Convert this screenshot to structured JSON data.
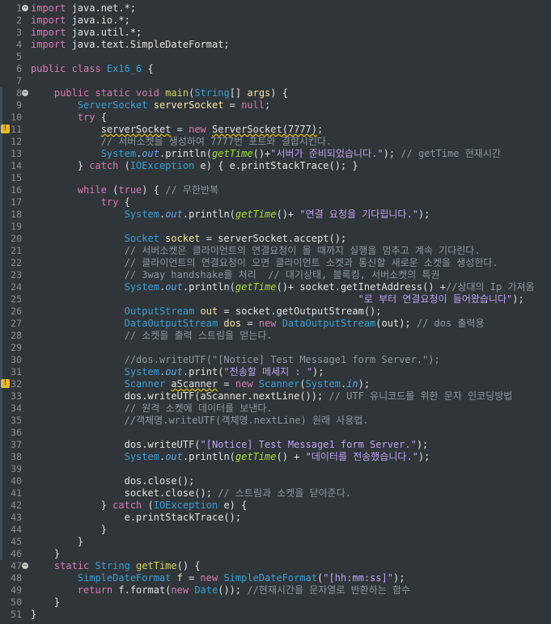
{
  "file": {
    "lines": [
      {
        "n": "1",
        "fold": "minus",
        "tokens": [
          [
            "kw",
            "import "
          ],
          [
            "pl",
            "java.net.*;"
          ]
        ]
      },
      {
        "n": "2",
        "tokens": [
          [
            "kw",
            "import "
          ],
          [
            "pl",
            "java.io.*;"
          ]
        ]
      },
      {
        "n": "3",
        "tokens": [
          [
            "kw",
            "import "
          ],
          [
            "pl",
            "java.util.*;"
          ]
        ]
      },
      {
        "n": "4",
        "tokens": [
          [
            "kw",
            "import "
          ],
          [
            "pl",
            "java.text.SimpleDateFormat;"
          ]
        ]
      },
      {
        "n": "5",
        "tokens": []
      },
      {
        "n": "6",
        "tokens": [
          [
            "kw",
            "public class "
          ],
          [
            "ty",
            "Ex16_6"
          ],
          [
            "pl",
            " {"
          ]
        ]
      },
      {
        "n": "7",
        "tokens": []
      },
      {
        "n": "8",
        "fold": "minus",
        "tokens": [
          [
            "pl",
            "    "
          ],
          [
            "kw",
            "public static void "
          ],
          [
            "fn",
            "main"
          ],
          [
            "pl",
            "("
          ],
          [
            "ty",
            "String"
          ],
          [
            "pl",
            "[] "
          ],
          [
            "var",
            "args"
          ],
          [
            "pl",
            ") {"
          ]
        ]
      },
      {
        "n": "9",
        "tokens": [
          [
            "pl",
            "        "
          ],
          [
            "ty",
            "ServerSocket "
          ],
          [
            "var",
            "serverSocket"
          ],
          [
            "pl",
            " = "
          ],
          [
            "kw",
            "null"
          ],
          [
            "pl",
            ";"
          ]
        ]
      },
      {
        "n": "10",
        "tokens": [
          [
            "pl",
            "        "
          ],
          [
            "kw",
            "try"
          ],
          [
            "pl",
            " {"
          ]
        ]
      },
      {
        "n": "11",
        "warn": true,
        "tokens": [
          [
            "pl",
            "            "
          ],
          [
            "err",
            "serverSocket"
          ],
          [
            "pl",
            " = "
          ],
          [
            "kw",
            "new "
          ],
          [
            "err",
            "ServerSocket(7777)"
          ],
          [
            "pl",
            ";"
          ]
        ]
      },
      {
        "n": "12",
        "tokens": [
          [
            "pl",
            "            "
          ],
          [
            "cm",
            "// 서버소켓을 생성하여 7777번 포트와 결합시킨다."
          ]
        ]
      },
      {
        "n": "13",
        "tokens": [
          [
            "pl",
            "            "
          ],
          [
            "ty",
            "System"
          ],
          [
            "pl",
            "."
          ],
          [
            "fld",
            "out"
          ],
          [
            "pl",
            ".println("
          ],
          [
            "sm",
            "getTime"
          ],
          [
            "pl",
            "()+"
          ],
          [
            "str",
            "\"서버가 준비되었습니다.\""
          ],
          [
            "pl",
            "); "
          ],
          [
            "cm",
            "// getTime 현재시간"
          ]
        ]
      },
      {
        "n": "14",
        "tokens": [
          [
            "pl",
            "        } "
          ],
          [
            "kw",
            "catch"
          ],
          [
            "pl",
            " ("
          ],
          [
            "ty",
            "IOException"
          ],
          [
            "pl",
            " e) { e.printStackTrace(); }"
          ]
        ]
      },
      {
        "n": "15",
        "tokens": []
      },
      {
        "n": "16",
        "tokens": [
          [
            "pl",
            "        "
          ],
          [
            "kw",
            "while"
          ],
          [
            "pl",
            " ("
          ],
          [
            "kw",
            "true"
          ],
          [
            "pl",
            ") { "
          ],
          [
            "cm",
            "// 무한반복"
          ]
        ]
      },
      {
        "n": "17",
        "tokens": [
          [
            "pl",
            "            "
          ],
          [
            "kw",
            "try"
          ],
          [
            "pl",
            " {"
          ]
        ]
      },
      {
        "n": "18",
        "tokens": [
          [
            "pl",
            "                "
          ],
          [
            "ty",
            "System"
          ],
          [
            "pl",
            "."
          ],
          [
            "fld",
            "out"
          ],
          [
            "pl",
            ".println("
          ],
          [
            "sm",
            "getTime"
          ],
          [
            "pl",
            "()+ "
          ],
          [
            "str",
            "\"연결 요청을 기다립니다.\""
          ],
          [
            "pl",
            ");"
          ]
        ]
      },
      {
        "n": "19",
        "tokens": []
      },
      {
        "n": "20",
        "tokens": [
          [
            "pl",
            "                "
          ],
          [
            "ty",
            "Socket "
          ],
          [
            "var",
            "socket"
          ],
          [
            "pl",
            " = serverSocket.accept();"
          ]
        ]
      },
      {
        "n": "21",
        "tokens": [
          [
            "pl",
            "                "
          ],
          [
            "cm",
            "// 서버소켓은 클라이언트의 연결요청이 올 때까지 실행을 멈추고 계속 기다린다."
          ]
        ]
      },
      {
        "n": "22",
        "tokens": [
          [
            "pl",
            "                "
          ],
          [
            "cm",
            "// 클라이언트의 연결요청이 오면 클라이언트 소켓과 통신할 새로운 소켓을 생성한다."
          ]
        ]
      },
      {
        "n": "23",
        "tokens": [
          [
            "pl",
            "                "
          ],
          [
            "cm",
            "// 3way handshake를 처리  // 대기상태, 블록킹, 서버소켓의 특권"
          ]
        ]
      },
      {
        "n": "24",
        "tokens": [
          [
            "pl",
            "                "
          ],
          [
            "ty",
            "System"
          ],
          [
            "pl",
            "."
          ],
          [
            "fld",
            "out"
          ],
          [
            "pl",
            ".println("
          ],
          [
            "sm",
            "getTime"
          ],
          [
            "pl",
            "()+ socket.getInetAddress() +"
          ],
          [
            "cm",
            "//상대의 Ip 가져옴"
          ]
        ]
      },
      {
        "n": "25",
        "tokens": [
          [
            "pl",
            "                                                        "
          ],
          [
            "str",
            "\"로 부터 연결요청이 들어왔습니다\""
          ],
          [
            "pl",
            ");"
          ]
        ]
      },
      {
        "n": "26",
        "tokens": [
          [
            "pl",
            "                "
          ],
          [
            "ty",
            "OutputStream "
          ],
          [
            "var",
            "out"
          ],
          [
            "pl",
            " = socket.getOutputStream();"
          ]
        ]
      },
      {
        "n": "27",
        "tokens": [
          [
            "pl",
            "                "
          ],
          [
            "ty",
            "DataOutputStream "
          ],
          [
            "var",
            "dos"
          ],
          [
            "pl",
            " = "
          ],
          [
            "kw",
            "new "
          ],
          [
            "ty",
            "DataOutputStream"
          ],
          [
            "pl",
            "(out); "
          ],
          [
            "cm",
            "// dos 출력용"
          ]
        ]
      },
      {
        "n": "28",
        "tokens": [
          [
            "pl",
            "                "
          ],
          [
            "cm",
            "// 소켓을 출력 스트림을 얻는다."
          ]
        ]
      },
      {
        "n": "29",
        "tokens": []
      },
      {
        "n": "30",
        "tokens": [
          [
            "pl",
            "                "
          ],
          [
            "cm",
            "//dos.writeUTF(\"[Notice] Test Message1 form Server.\");"
          ]
        ]
      },
      {
        "n": "31",
        "tokens": [
          [
            "pl",
            "                "
          ],
          [
            "ty",
            "System"
          ],
          [
            "pl",
            "."
          ],
          [
            "fld",
            "out"
          ],
          [
            "pl",
            ".print("
          ],
          [
            "str",
            "\"전송할 메세지 : \""
          ],
          [
            "pl",
            ");"
          ]
        ]
      },
      {
        "n": "32",
        "warn": true,
        "tokens": [
          [
            "pl",
            "                "
          ],
          [
            "ty",
            "Scanner "
          ],
          [
            "err",
            "aScanner"
          ],
          [
            "pl",
            " = "
          ],
          [
            "kw",
            "new "
          ],
          [
            "ty",
            "Scanner"
          ],
          [
            "pl",
            "("
          ],
          [
            "ty",
            "System"
          ],
          [
            "pl",
            "."
          ],
          [
            "fld",
            "in"
          ],
          [
            "pl",
            ");"
          ]
        ]
      },
      {
        "n": "33",
        "tokens": [
          [
            "pl",
            "                dos.writeUTF(aScanner.nextLine()); "
          ],
          [
            "cm",
            "// UTF 유니코드를 위한 문자 인코딩방법"
          ]
        ]
      },
      {
        "n": "34",
        "tokens": [
          [
            "pl",
            "                "
          ],
          [
            "cm",
            "// 원격 소켓에 데이터를 보낸다."
          ]
        ]
      },
      {
        "n": "35",
        "tokens": [
          [
            "pl",
            "                "
          ],
          [
            "cm",
            "//객체명.writeUTF(객체명.nextLine) 원래 사용법."
          ]
        ]
      },
      {
        "n": "36",
        "tokens": []
      },
      {
        "n": "37",
        "tokens": [
          [
            "pl",
            "                dos.writeUTF("
          ],
          [
            "str",
            "\"[Notice] Test Message1 form Server.\""
          ],
          [
            "pl",
            ");"
          ]
        ]
      },
      {
        "n": "38",
        "tokens": [
          [
            "pl",
            "                "
          ],
          [
            "ty",
            "System"
          ],
          [
            "pl",
            "."
          ],
          [
            "fld",
            "out"
          ],
          [
            "pl",
            ".println("
          ],
          [
            "sm",
            "getTime"
          ],
          [
            "pl",
            "() + "
          ],
          [
            "str",
            "\"데이터를 전송했습니다.\""
          ],
          [
            "pl",
            ");"
          ]
        ]
      },
      {
        "n": "39",
        "tokens": []
      },
      {
        "n": "40",
        "tokens": [
          [
            "pl",
            "                dos.close();"
          ]
        ]
      },
      {
        "n": "41",
        "tokens": [
          [
            "pl",
            "                socket.close(); "
          ],
          [
            "cm",
            "// 스트림과 소켓을 닫아준다."
          ]
        ]
      },
      {
        "n": "42",
        "tokens": [
          [
            "pl",
            "            } "
          ],
          [
            "kw",
            "catch"
          ],
          [
            "pl",
            " ("
          ],
          [
            "ty",
            "IOException"
          ],
          [
            "pl",
            " e) {"
          ]
        ]
      },
      {
        "n": "43",
        "tokens": [
          [
            "pl",
            "                e.printStackTrace();"
          ]
        ]
      },
      {
        "n": "44",
        "tokens": [
          [
            "pl",
            "            }"
          ]
        ]
      },
      {
        "n": "45",
        "tokens": [
          [
            "pl",
            "        }"
          ]
        ]
      },
      {
        "n": "46",
        "tokens": [
          [
            "pl",
            "    }"
          ]
        ]
      },
      {
        "n": "47",
        "fold": "minus",
        "tokens": [
          [
            "pl",
            "    "
          ],
          [
            "kw",
            "static "
          ],
          [
            "ty",
            "String "
          ],
          [
            "fn",
            "getTime"
          ],
          [
            "pl",
            "() {"
          ]
        ]
      },
      {
        "n": "48",
        "tokens": [
          [
            "pl",
            "        "
          ],
          [
            "ty",
            "SimpleDateFormat "
          ],
          [
            "var",
            "f"
          ],
          [
            "pl",
            " = "
          ],
          [
            "kw",
            "new "
          ],
          [
            "ty",
            "SimpleDateFormat"
          ],
          [
            "pl",
            "("
          ],
          [
            "str",
            "\"[hh:mm:ss]\""
          ],
          [
            "pl",
            ");"
          ]
        ]
      },
      {
        "n": "49",
        "tokens": [
          [
            "pl",
            "        "
          ],
          [
            "kw",
            "return "
          ],
          [
            "pl",
            "f.format("
          ],
          [
            "kw",
            "new "
          ],
          [
            "ty",
            "Date"
          ],
          [
            "pl",
            "()); "
          ],
          [
            "cm",
            "//현재시간을 문자열로 반환하는 함수"
          ]
        ]
      },
      {
        "n": "50",
        "tokens": [
          [
            "pl",
            "    }"
          ]
        ]
      },
      {
        "n": "51",
        "tokens": [
          [
            "pl",
            "}"
          ]
        ]
      }
    ]
  }
}
